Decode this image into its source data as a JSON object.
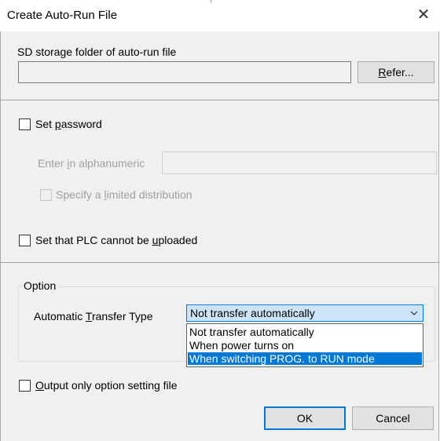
{
  "window": {
    "title": "Create Auto-Run File",
    "close_icon": "close-icon"
  },
  "sd_folder": {
    "label": "SD storage folder of auto-run file",
    "value": "",
    "refer_button": {
      "pre": "",
      "accel": "R",
      "post": "efer..."
    }
  },
  "password": {
    "checkbox_checked": false,
    "label": {
      "pre": "Set ",
      "accel": "p",
      "post": "assword"
    },
    "enter_label": {
      "pre": "Enter ",
      "accel": "i",
      "post": "n alphanumeric"
    },
    "enter_value": "",
    "limited_distribution": {
      "checked": false,
      "label": {
        "pre": "Specify a ",
        "accel": "l",
        "post": "imited distribution"
      }
    }
  },
  "no_upload": {
    "checked": false,
    "label": {
      "pre": "Set that PLC cannot be ",
      "accel": "u",
      "post": "ploaded"
    }
  },
  "option": {
    "group_label": "Option",
    "transfer_type_label": {
      "pre": "Automatic ",
      "accel": "T",
      "post": "ransfer Type"
    },
    "selected_value": "Not transfer automatically",
    "dropdown_options": [
      "Not transfer automatically",
      "When power turns on",
      "When switching PROG. to RUN mode"
    ],
    "highlighted_index": 2
  },
  "output_only": {
    "checked": false,
    "label": {
      "pre": "",
      "accel": "O",
      "post": "utput only option setting file"
    }
  },
  "buttons": {
    "ok": "OK",
    "cancel": "Cancel"
  },
  "colors": {
    "accent": "#0078d7",
    "dialog_bg": "#f0f0f0",
    "combo_bg": "#cce4f7"
  }
}
